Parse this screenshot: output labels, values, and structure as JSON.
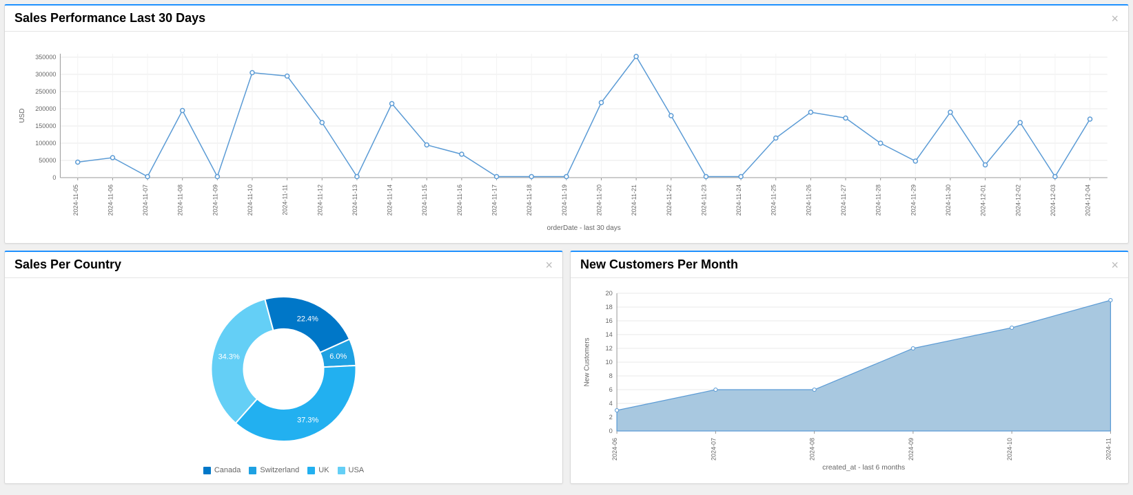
{
  "chart_data": [
    {
      "id": "sales30",
      "type": "line",
      "title": "Sales Performance Last 30 Days",
      "ylabel": "USD",
      "xlabel": "orderDate - last 30 days",
      "ylim": [
        0,
        360000
      ],
      "yticks": [
        0,
        50000,
        100000,
        150000,
        200000,
        250000,
        300000,
        350000
      ],
      "categories": [
        "2024-11-05",
        "2024-11-06",
        "2024-11-07",
        "2024-11-08",
        "2024-11-09",
        "2024-11-10",
        "2024-11-11",
        "2024-11-12",
        "2024-11-13",
        "2024-11-14",
        "2024-11-15",
        "2024-11-16",
        "2024-11-17",
        "2024-11-18",
        "2024-11-19",
        "2024-11-20",
        "2024-11-21",
        "2024-11-22",
        "2024-11-23",
        "2024-11-24",
        "2024-11-25",
        "2024-11-26",
        "2024-11-27",
        "2024-11-28",
        "2024-11-29",
        "2024-11-30",
        "2024-12-01",
        "2024-12-02",
        "2024-12-03",
        "2024-12-04"
      ],
      "values": [
        45000,
        58000,
        3000,
        195000,
        3000,
        305000,
        295000,
        160000,
        3000,
        215000,
        95000,
        68000,
        3000,
        3000,
        3000,
        218000,
        352000,
        180000,
        3000,
        3000,
        115000,
        190000,
        173000,
        100000,
        48000,
        190000,
        37000,
        160000,
        3000,
        170000
      ]
    },
    {
      "id": "salesCountry",
      "type": "pie",
      "title": "Sales Per Country",
      "series": [
        {
          "name": "Canada",
          "value": 22.4,
          "label": "22.4%",
          "color": "#0077c8"
        },
        {
          "name": "Switzerland",
          "value": 6.0,
          "label": "6.0%",
          "color": "#1ea1e2"
        },
        {
          "name": "UK",
          "value": 37.3,
          "label": "37.3%",
          "color": "#22b0f0"
        },
        {
          "name": "USA",
          "value": 34.3,
          "label": "34.3%",
          "color": "#64cff6"
        }
      ]
    },
    {
      "id": "newCustomers",
      "type": "area",
      "title": "New Customers Per Month",
      "ylabel": "New Customers",
      "xlabel": "created_at - last 6 months",
      "ylim": [
        0,
        20
      ],
      "yticks": [
        0,
        2,
        4,
        6,
        8,
        10,
        12,
        14,
        16,
        18,
        20
      ],
      "categories": [
        "2024-06",
        "2024-07",
        "2024-08",
        "2024-09",
        "2024-10",
        "2024-11"
      ],
      "values": [
        3,
        6,
        6,
        12,
        15,
        19
      ]
    }
  ]
}
